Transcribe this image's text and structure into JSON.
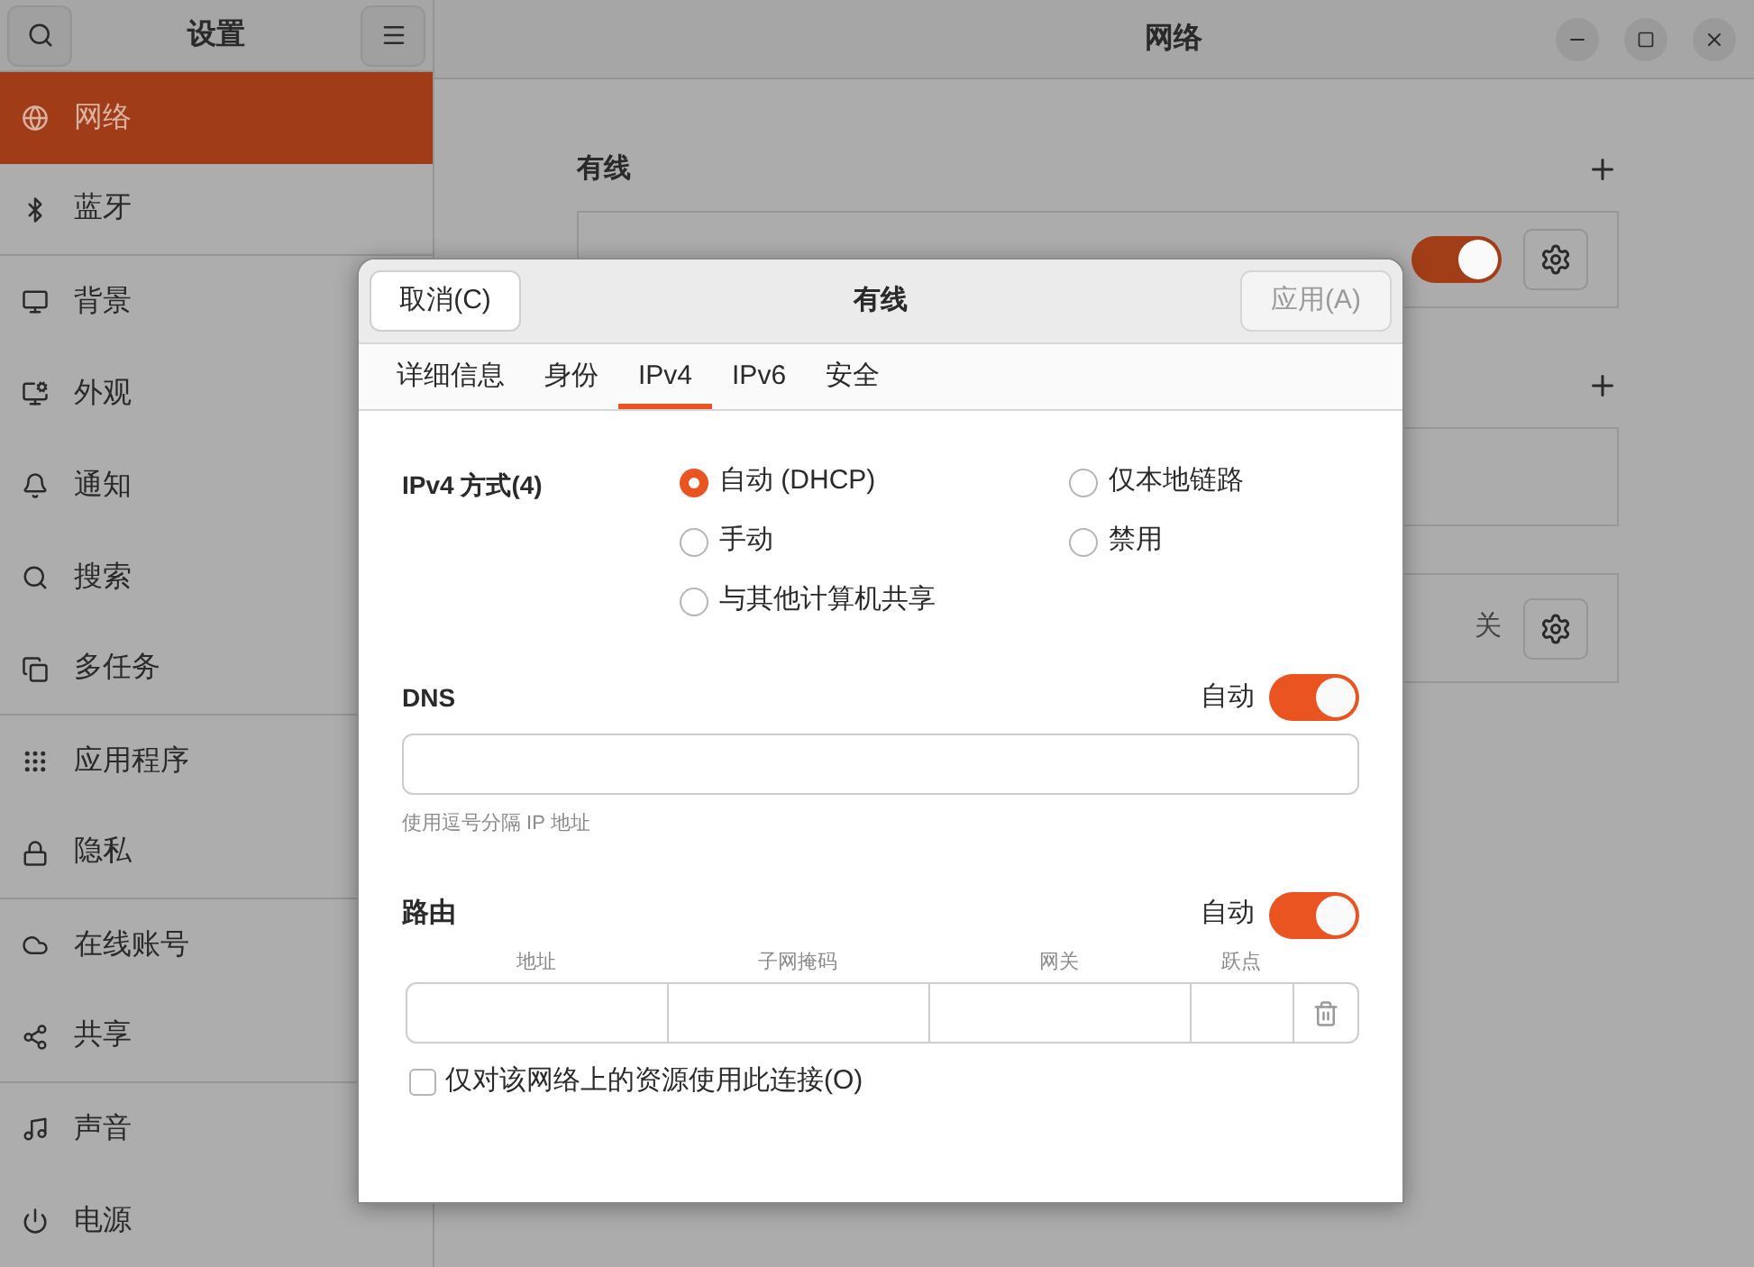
{
  "sidebar": {
    "title": "设置",
    "items": [
      {
        "label": "网络",
        "selected": true,
        "divider": false
      },
      {
        "label": "蓝牙",
        "selected": false,
        "divider": true
      },
      {
        "label": "背景",
        "selected": false,
        "divider": false
      },
      {
        "label": "外观",
        "selected": false,
        "divider": false
      },
      {
        "label": "通知",
        "selected": false,
        "divider": false
      },
      {
        "label": "搜索",
        "selected": false,
        "divider": false
      },
      {
        "label": "多任务",
        "selected": false,
        "divider": true
      },
      {
        "label": "应用程序",
        "selected": false,
        "divider": false
      },
      {
        "label": "隐私",
        "selected": false,
        "divider": true
      },
      {
        "label": "在线账号",
        "selected": false,
        "divider": false
      },
      {
        "label": "共享",
        "selected": false,
        "divider": true
      },
      {
        "label": "声音",
        "selected": false,
        "divider": false
      },
      {
        "label": "电源",
        "selected": false,
        "divider": false
      }
    ]
  },
  "window": {
    "title": "网络"
  },
  "wired": {
    "heading": "有线",
    "on": true
  },
  "third": {
    "state": "关"
  },
  "dialog": {
    "cancel": "取消(C)",
    "title": "有线",
    "apply": "应用(A)",
    "apply_disabled": true,
    "tabs": [
      {
        "label": "详细信息",
        "selected": false
      },
      {
        "label": "身份",
        "selected": false
      },
      {
        "label": "IPv4",
        "selected": true
      },
      {
        "label": "IPv6",
        "selected": false
      },
      {
        "label": "安全",
        "selected": false
      }
    ],
    "method_label": "IPv4 方式(4)",
    "methods": [
      {
        "label": "自动 (DHCP)",
        "selected": true
      },
      {
        "label": "仅本地链路",
        "selected": false
      },
      {
        "label": "手动",
        "selected": false
      },
      {
        "label": "禁用",
        "selected": false
      },
      {
        "label": "与其他计算机共享",
        "selected": false
      }
    ],
    "dns": {
      "label": "DNS",
      "auto_label": "自动",
      "auto": true,
      "hint": "使用逗号分隔 IP 地址"
    },
    "routes": {
      "label": "路由",
      "auto_label": "自动",
      "auto": true,
      "columns": [
        "地址",
        "子网掩码",
        "网关",
        "跃点"
      ]
    },
    "only_local": {
      "label": "仅对该网络上的资源使用此连接(O)",
      "checked": false
    }
  }
}
